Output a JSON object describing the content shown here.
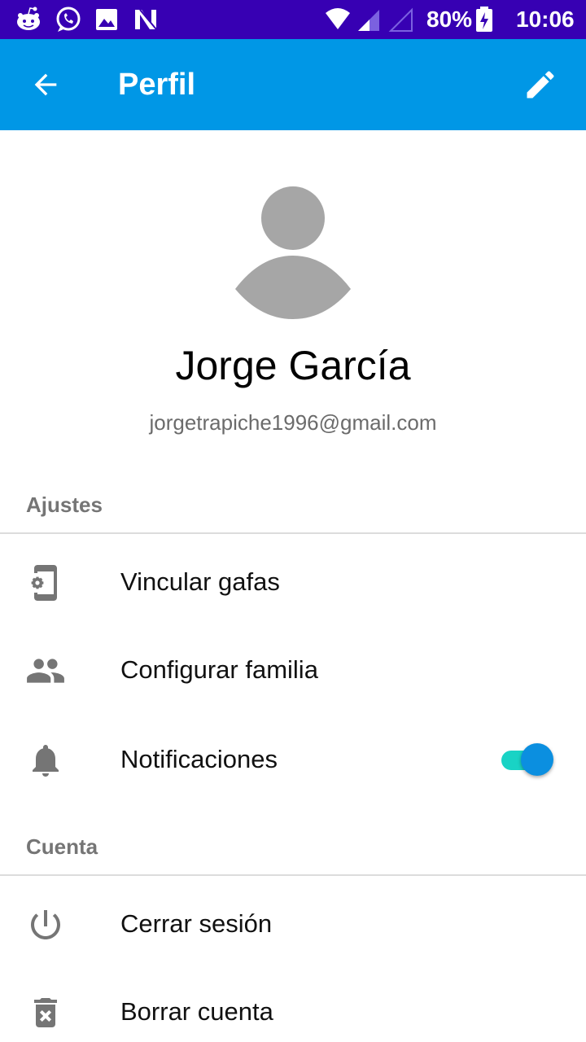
{
  "status_bar": {
    "battery": "80%",
    "time": "10:06",
    "icons": [
      "reddit-icon",
      "whatsapp-icon",
      "gallery-icon",
      "n-app-icon",
      "wifi-icon",
      "signal-icon",
      "signal-empty-icon",
      "battery-charging-icon"
    ]
  },
  "app_bar": {
    "title": "Perfil",
    "back_icon": "arrow-back-icon",
    "edit_icon": "pencil-icon"
  },
  "profile": {
    "name": "Jorge García",
    "email": "jorgetrapiche1996@gmail.com"
  },
  "settings": {
    "header": "Ajustes",
    "items": [
      {
        "label": "Vincular gafas",
        "icon": "phone-settings-icon"
      },
      {
        "label": "Configurar familia",
        "icon": "people-icon"
      },
      {
        "label": "Notificaciones",
        "icon": "bell-icon",
        "toggle_on": true
      }
    ]
  },
  "account": {
    "header": "Cuenta",
    "items": [
      {
        "label": "Cerrar sesión",
        "icon": "power-icon"
      },
      {
        "label": "Borrar cuenta",
        "icon": "delete-icon"
      }
    ]
  },
  "colors": {
    "status_bar": "#3700b3",
    "app_bar": "#0097e6",
    "toggle_track": "#19d3c5",
    "toggle_thumb": "#0b8fe0"
  }
}
